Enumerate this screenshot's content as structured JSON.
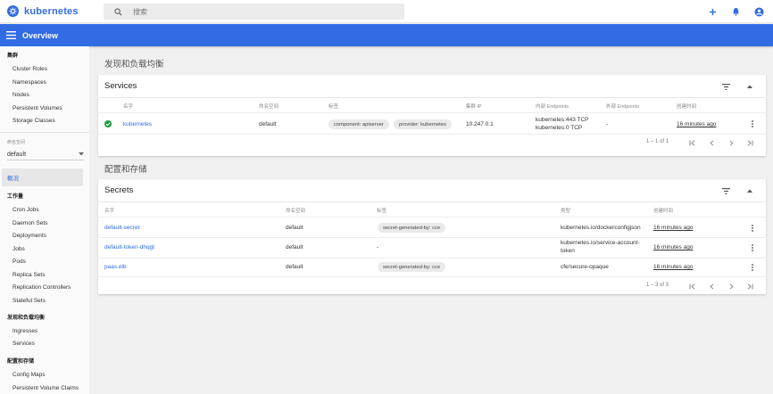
{
  "header": {
    "logo_text": "kubernetes",
    "search_placeholder": "搜索"
  },
  "toolbar": {
    "title": "Overview"
  },
  "sidebar": {
    "cluster_header": "集群",
    "cluster_items": [
      "Cluster Roles",
      "Namespaces",
      "Nodes",
      "Persistent Volumes",
      "Storage Classes"
    ],
    "namespace_label": "命名空间",
    "namespace_value": "default",
    "overview": "概况",
    "workloads_header": "工作量",
    "workload_items": [
      "Cron Jobs",
      "Daemon Sets",
      "Deployments",
      "Jobs",
      "Pods",
      "Replica Sets",
      "Replication Controllers",
      "Stateful Sets"
    ],
    "discovery_header": "发现和负载均衡",
    "discovery_items": [
      "Ingresses",
      "Services"
    ],
    "config_header": "配置和存储",
    "config_items": [
      "Config Maps",
      "Persistent Volume Claims"
    ]
  },
  "discovery": {
    "section_title": "发现和负载均衡",
    "card_title": "Services",
    "columns": [
      "名字",
      "命名空间",
      "标签",
      "集群 IP",
      "内部 Endpoints",
      "外部 Endpoints",
      "创建时间"
    ],
    "rows": [
      {
        "name": "kubernetes",
        "namespace": "default",
        "labels": [
          "component: apiserver",
          "provider: kubernetes"
        ],
        "cluster_ip": "10.247.0.1",
        "internal_endpoints": [
          "kubernetes:443 TCP",
          "kubernetes:0 TCP"
        ],
        "external_endpoints": "-",
        "age": "16 minutes ago",
        "status_color": "#1e9c3b"
      }
    ],
    "pagination": "1 – 1 of 1"
  },
  "config": {
    "section_title": "配置和存储",
    "card_title": "Secrets",
    "columns": [
      "名字",
      "命名空间",
      "标签",
      "类型",
      "创建时间"
    ],
    "rows": [
      {
        "name": "default-secret",
        "namespace": "default",
        "label": "secret-generated-by: cce",
        "type": [
          "kubernetes.io/dockerconfigjson"
        ],
        "age": "16 minutes ago"
      },
      {
        "name": "default-token-dhqgt",
        "namespace": "default",
        "label": "-",
        "type": [
          "kubernetes.io/service-account-",
          "token"
        ],
        "age": "16 minutes ago"
      },
      {
        "name": "paas.elb",
        "namespace": "default",
        "label": "secret-generated-by: cce",
        "type": [
          "cfe/secure-opaque"
        ],
        "age": "16 minutes ago"
      }
    ],
    "pagination": "1 – 3 of 3"
  },
  "colors": {
    "brand": "#326ce5",
    "success": "#1e9c3b"
  },
  "icons": {
    "logo": "helm-wheel-icon",
    "search": "search-icon",
    "add": "plus-icon",
    "notifications": "bell-icon",
    "account": "account-icon",
    "menu": "menu-icon"
  }
}
